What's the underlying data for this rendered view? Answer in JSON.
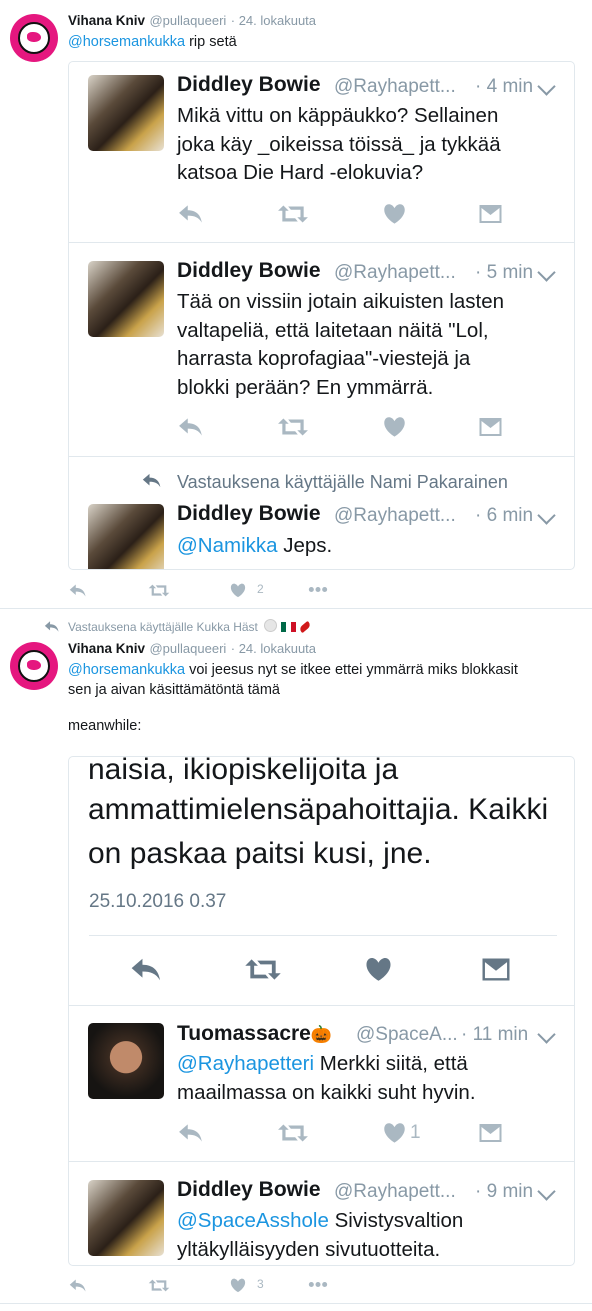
{
  "tweet1": {
    "name": "Vihana Kniv",
    "handle": "@pullaqueeri",
    "date": "· 24. lokakuuta",
    "mention": "@horsemankukka",
    "text": " rip setä",
    "like_count": "2"
  },
  "quoted1": [
    {
      "name": "Diddley Bowie",
      "handle": "@Rayhapett...",
      "time": "· 4 min",
      "lines": [
        "Mikä vittu on käppäukko? Sellainen",
        "joka käy _oikeissa töissä_ ja tykkää",
        "katsoa Die Hard -elokuvia?"
      ]
    },
    {
      "name": "Diddley Bowie",
      "handle": "@Rayhapett...",
      "time": "· 5 min",
      "lines": [
        "Tää on vissiin jotain aikuisten lasten",
        "valtapeliä, että laitetaan näitä \"Lol,",
        "harrasta koprofagiaa\"-viestejä ja",
        "blokki perään? En ymmärrä."
      ]
    },
    {
      "reply_to": "Vastauksena käyttäjälle Nami Pakarainen",
      "name": "Diddley Bowie",
      "handle": "@Rayhapett...",
      "time": "· 6 min",
      "mention": "@Namikka",
      "text": " Jeps."
    }
  ],
  "tweet2": {
    "reply_to": "Vastauksena käyttäjälle Kukka Häst",
    "name": "Vihana Kniv",
    "handle": "@pullaqueeri",
    "date": "· 24. lokakuuta",
    "mention": "@horsemankukka",
    "text_line1": " voi jeesus nyt se itkee ettei ymmärrä miks blokkasit",
    "text_line2": "sen ja aivan käsittämätöntä tämä",
    "text_line3": "meanwhile:",
    "like_count": "3"
  },
  "quoted2": {
    "lines": [
      "naisia, ikiopiskelijoita ja",
      "ammattimielensäpahoittajia. Kaikki",
      "on paskaa paitsi kusi, jne."
    ],
    "timestamp": "25.10.2016 0.37",
    "replies": [
      {
        "name": "Tuomassacre",
        "emoji": "🎃",
        "handle": "@SpaceA...",
        "time": "· 11 min",
        "mention": "@Rayhapetteri",
        "text_line1": " Merkki siitä, että",
        "text_line2": "maailmassa on kaikki suht hyvin.",
        "like_count": "1"
      },
      {
        "name": "Diddley Bowie",
        "handle": "@Rayhapett...",
        "time": "· 9 min",
        "mention": "@SpaceAsshole",
        "text_line1": " Sivistysvaltion",
        "text_line2": "yltäkylläisyyden sivutuotteita."
      }
    ]
  },
  "colors": {
    "link": "#1b95e0",
    "icon": "#aab8c2",
    "meta": "#8899a6",
    "border": "#e1e8ed",
    "avatar": "#e5177f"
  },
  "icons": [
    "reply-icon",
    "retweet-icon",
    "heart-icon",
    "message-icon",
    "more-icon",
    "chevron-down-icon"
  ]
}
